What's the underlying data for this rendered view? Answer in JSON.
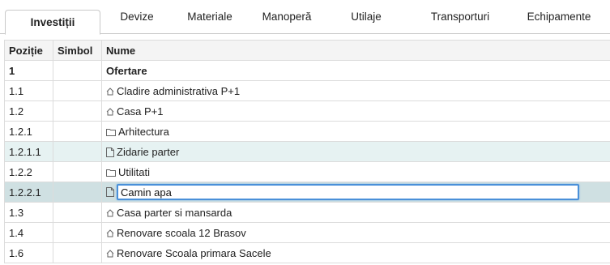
{
  "tabs": [
    {
      "label": "Investiții"
    },
    {
      "label": "Devize"
    },
    {
      "label": "Materiale"
    },
    {
      "label": "Manoperă"
    },
    {
      "label": "Utilaje"
    },
    {
      "label": "Transporturi"
    },
    {
      "label": "Echipamente"
    }
  ],
  "columns": {
    "pozitie": "Poziție",
    "simbol": "Simbol",
    "nume": "Nume"
  },
  "rows": [
    {
      "pozitie": "1",
      "simbol": "",
      "nume": "Ofertare",
      "icon": "none"
    },
    {
      "pozitie": "1.1",
      "simbol": "",
      "nume": "Cladire administrativa P+1",
      "icon": "home-icon"
    },
    {
      "pozitie": "1.2",
      "simbol": "",
      "nume": "Casa P+1",
      "icon": "home-icon"
    },
    {
      "pozitie": "1.2.1",
      "simbol": "",
      "nume": "Arhitectura",
      "icon": "folder-icon"
    },
    {
      "pozitie": "1.2.1.1",
      "simbol": "",
      "nume": "Zidarie parter",
      "icon": "file-icon"
    },
    {
      "pozitie": "1.2.2",
      "simbol": "",
      "nume": "Utilitati",
      "icon": "folder-icon"
    },
    {
      "pozitie": "1.2.2.1",
      "simbol": "",
      "nume": "Camin apa",
      "icon": "file-icon",
      "editing": true
    },
    {
      "pozitie": "1.3",
      "simbol": "",
      "nume": "Casa parter si mansarda",
      "icon": "home-icon"
    },
    {
      "pozitie": "1.4",
      "simbol": "",
      "nume": "Renovare scoala 12 Brasov",
      "icon": "home-icon"
    },
    {
      "pozitie": "1.6",
      "simbol": "",
      "nume": "Renovare Scoala primara Sacele",
      "icon": "home-icon"
    }
  ],
  "colors": {
    "accent": "#4a90d9",
    "row_highlight": "#e6f2f2",
    "row_selected": "#cfe0e2"
  }
}
